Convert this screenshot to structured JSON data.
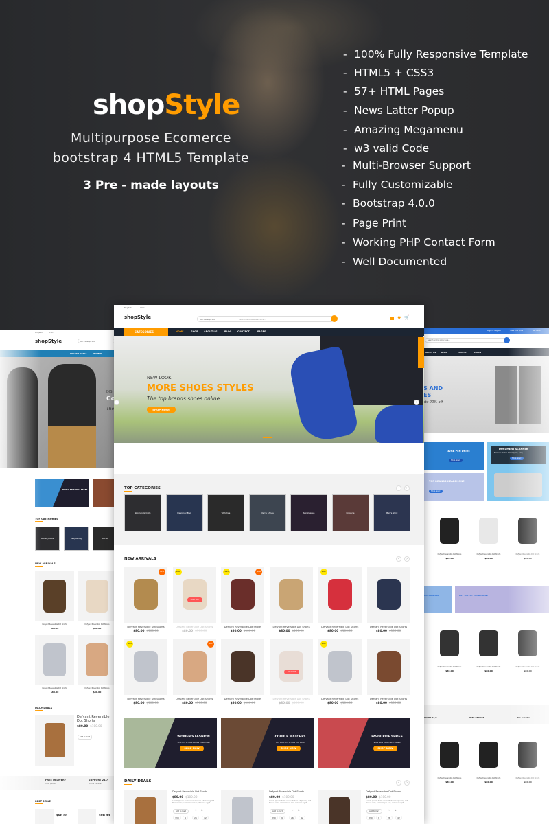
{
  "hero": {
    "logo": {
      "part1": "shop",
      "part2": "Style"
    },
    "subtitle1": "Multipurpose Ecomerce",
    "subtitle2": "bootstrap 4 HTML5 Template",
    "layouts": "3 Pre - made layouts",
    "features": [
      "100% Fully Responsive Template",
      "HTML5 + CSS3",
      "57+ HTML Pages",
      "News Latter Popup",
      "Amazing Megamenu",
      "w3 valid Code",
      "Multi-Browser Support",
      "Fully Customizable",
      "Bootstrap 4.0.0",
      "Page Print",
      "Working PHP Contact Form",
      "Well Documented"
    ]
  },
  "colors": {
    "accent": "#ff9c00",
    "nav": "#1c2532",
    "blue": "#1f7fb5",
    "right_blue": "#2b6fd6"
  },
  "center": {
    "lang": "English",
    "currency": "USD",
    "logo": "shopStyle",
    "category_select": "All Categories",
    "search_placeholder": "Search entire store here...",
    "categories_label": "CATEGORIES",
    "nav": [
      "HOME",
      "SHOP",
      "ABOUT US",
      "BLOG",
      "CONTACT",
      "PAGES"
    ],
    "slider": {
      "kicker": "NEW LOOK",
      "title": "MORE SHOES STYLES",
      "subtitle": "The top brands shoes online.",
      "button": "SHOP NOW!"
    },
    "top_categories_title": "TOP CATEGORIES",
    "categories": [
      "Women Jackets",
      "Designer Bag",
      "Watches",
      "Men's Shoes",
      "Sunglasses",
      "Lingerie",
      "Men's Shirt"
    ],
    "new_arrivals_title": "NEW ARRIVALS",
    "products": [
      {
        "name": "Defyant Reversible Dot Shorts",
        "price": "$80.00",
        "old": "$100.00",
        "badges": [
          "NEW"
        ],
        "color": "#b38b4f"
      },
      {
        "name": "Defyant Reversible Dot Shorts",
        "price": "$80.00",
        "old": "$100.00",
        "badges": [
          "SALE"
        ],
        "sold": "SOLD OUT",
        "color": "#e8d8c4"
      },
      {
        "name": "Defyant Reversible Dot Shorts",
        "price": "$80.00",
        "old": "$100.00",
        "badges": [
          "SALE",
          "NEW"
        ],
        "color": "#6a2e2a"
      },
      {
        "name": "Defyant Reversible Dot Shorts",
        "price": "$80.00",
        "old": "$100.00",
        "badges": [],
        "color": "#c9a574"
      },
      {
        "name": "Defyant Reversible Dot Shorts",
        "price": "$80.00",
        "old": "$100.00",
        "badges": [
          "SALE"
        ],
        "color": "#d6303d"
      },
      {
        "name": "Defyant Reversible Dot Shorts",
        "price": "$80.00",
        "old": "$100.00",
        "badges": [],
        "color": "#2b3550"
      },
      {
        "name": "Defyant Reversible Dot Shorts",
        "price": "$80.00",
        "old": "$100.00",
        "badges": [
          "SALE"
        ],
        "color": "#c0c4cc"
      },
      {
        "name": "Defyant Reversible Dot Shorts",
        "price": "$80.00",
        "old": "$100.00",
        "badges": [
          "NEW"
        ],
        "color": "#d8a882"
      },
      {
        "name": "Defyant Reversible Dot Shorts",
        "price": "$80.00",
        "old": "$100.00",
        "badges": [],
        "color": "#4a3428"
      },
      {
        "name": "Defyant Reversible Dot Shorts",
        "price": "$80.00",
        "old": "$100.00",
        "badges": [],
        "sold": "SOLD OUT",
        "color": "#e8ddd6"
      },
      {
        "name": "Defyant Reversible Dot Shorts",
        "price": "$80.00",
        "old": "$100.00",
        "badges": [
          "SALE"
        ],
        "color": "#c0c4cc"
      },
      {
        "name": "Defyant Reversible Dot Shorts",
        "price": "$80.00",
        "old": "$100.00",
        "badges": [],
        "color": "#7a4a30"
      }
    ],
    "banners": [
      {
        "title": "WOMEN'S FASHION",
        "sub": "50%-70% OFF ON WOMEN'S CLOTHING",
        "button": "SHOP NOW",
        "color": "#a9b89a"
      },
      {
        "title": "COUPLE WATCHES",
        "sub": "BUY NOW 40% OFF ON THIS WEEK",
        "button": "SHOP NOW",
        "color": "#6b4a35"
      },
      {
        "title": "FAVOURITE SHOES",
        "sub": "SHOP NOW TODAY! BEST DEALS",
        "button": "SHOP NOW",
        "color": "#c94a4f"
      }
    ],
    "daily_deals_title": "DAILY DEALS",
    "deals": [
      {
        "name": "Defyant Reversible Dot Shorts",
        "price": "$80.00",
        "old": "$100.00",
        "desc": "Lorem ipsum dolor consectetuer adipiscing elit. Donec eros, scelerisque nec, rhoncus eget.",
        "cart": "Add to Cart",
        "countdown": [
          "330",
          "9",
          "26",
          "42"
        ],
        "color": "#a8703e"
      },
      {
        "name": "Defyant Reversible Dot Shorts",
        "price": "$80.00",
        "old": "$100.00",
        "desc": "Lorem ipsum dolor consectetuer adipiscing elit. Donec eros, scelerisque nec, rhoncus eget.",
        "cart": "Add to Cart",
        "countdown": [
          "330",
          "9",
          "26",
          "42"
        ],
        "color": "#c0c4cc"
      },
      {
        "name": "Defyant Reversible Dot Shorts",
        "price": "$80.00",
        "old": "$100.00",
        "desc": "Lorem ipsum dolor consectetuer adipiscing elit. Donec eros, scelerisque nec, rhoncus eget.",
        "cart": "Add to Cart",
        "countdown": [
          "330",
          "9",
          "26",
          "42"
        ],
        "color": "#4a3428"
      }
    ]
  },
  "left": {
    "lang": "English",
    "currency": "USD",
    "logo": "shopStyle",
    "category_select": "All Categories",
    "nav": [
      "TODAY'S DEALS",
      "WOMEN",
      "MEN"
    ],
    "slider": [
      "DIS",
      "Co",
      "The"
    ],
    "banner": "POPULAR SUNGLASSES",
    "top_categories_title": "TOP CATEGORIES",
    "categories": [
      "Women Jackets",
      "Designer Bag",
      "Watches"
    ],
    "new_arrivals_title": "NEW ARRIVALS",
    "product": {
      "name": "Defyant Reversible Dot Shorts",
      "price": "$80.00",
      "old": "$100.00"
    },
    "daily_deals_title": "DAILY DEALS",
    "deal": {
      "name": "Defyant Reversible Dot Shorts",
      "price": "$80.00",
      "old": "$100.00",
      "cart": "Add to Cart"
    },
    "services": [
      {
        "title": "FREE DELIVERY",
        "sub": "From $59.89"
      },
      {
        "title": "SUPPORT 24/7",
        "sub": "Online 24 hours"
      }
    ],
    "best_seller_title": "BEST SELLE",
    "best_price": "$80.00"
  },
  "right": {
    "top_links": [
      "Login or Register",
      "Track your order",
      "Gift cards"
    ],
    "search_placeholder": "Search entire store here...",
    "nav": [
      "ABOUT US",
      "BLOG",
      "CONTACT",
      "PAGES"
    ],
    "slider": [
      "S AND",
      "ES",
      "cts 20% off"
    ],
    "banners": [
      {
        "title": "32GB PEN DRIVE",
        "button": "Shop Now!"
      },
      {
        "title": "TOP BRANDS HEADPHONE",
        "button": "Shop Now!"
      },
      {
        "title": "DOCUMENT SCANNER",
        "sub": "Scanner Online Order quick, easy",
        "button": "Shop Now!"
      }
    ],
    "banners2": [
      "ATCH ONLINE",
      "GET LATEST HEADPHONE"
    ],
    "product": {
      "name": "Defyant Reversible Dot Shorts",
      "price": "$80.00",
      "old": "$100.00"
    },
    "services": [
      {
        "title": "PPORT 24/7"
      },
      {
        "title": "FREE RETURN"
      },
      {
        "title": "BIG SAVING"
      }
    ]
  }
}
